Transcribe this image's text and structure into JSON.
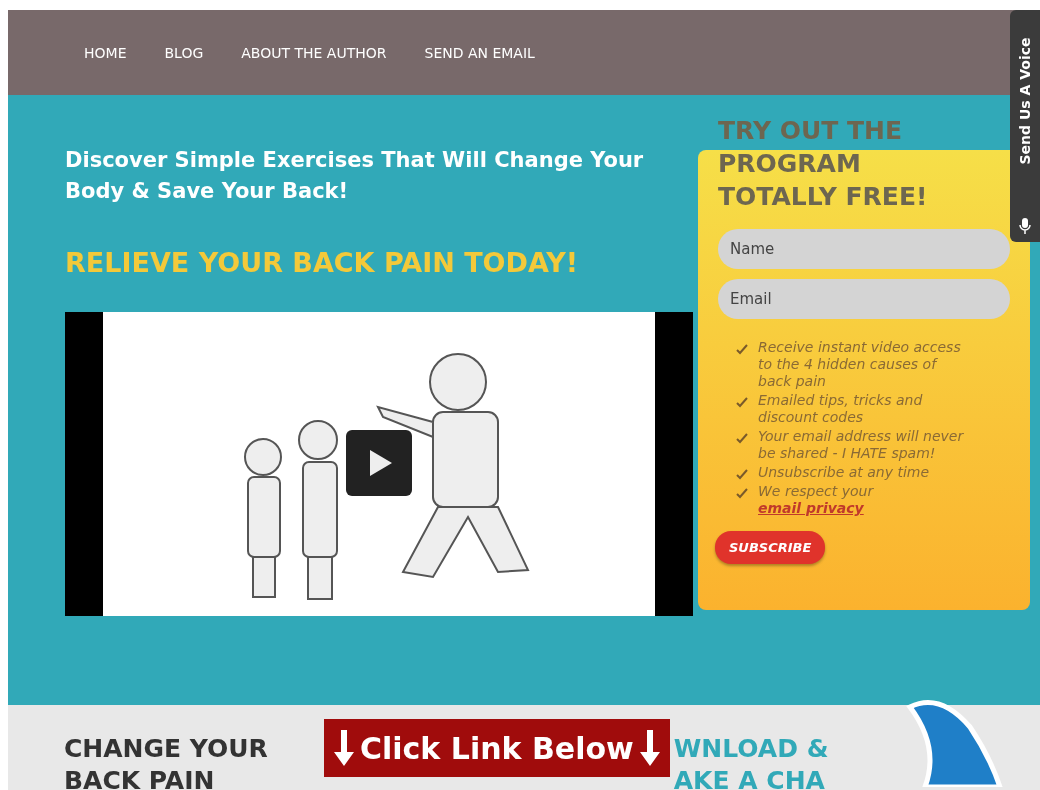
{
  "nav": {
    "items": [
      {
        "label": "HOME"
      },
      {
        "label": "BLOG"
      },
      {
        "label": "ABOUT THE AUTHOR"
      },
      {
        "label": "SEND AN EMAIL"
      }
    ]
  },
  "hero": {
    "title": "Discover Simple Exercises That Will Change Your Body & Save Your Back!",
    "headline": "RELIEVE YOUR BACK PAIN TODAY!"
  },
  "signup": {
    "title": "TRY OUT THE PROGRAM TOTALLY FREE!",
    "fields": [
      {
        "placeholder": "Name"
      },
      {
        "placeholder": "Email"
      }
    ],
    "benefits": [
      {
        "text": "Receive instant video access to the 4 hidden causes of back pain"
      },
      {
        "text": "Emailed tips, tricks and discount codes"
      },
      {
        "text": "Your email address will never be shared - I HATE spam!"
      },
      {
        "text": "Unsubscribe at any time"
      },
      {
        "text": "We respect your ",
        "link": "email privacy"
      }
    ],
    "button": "SUBSCRIBE"
  },
  "voice_tab": {
    "label": "Send Us A Voice"
  },
  "bottom": {
    "left_heading": [
      "CHANGE YOUR",
      "BACK PAIN"
    ],
    "banner": "Click Link Below",
    "right_heading": [
      "WNLOAD &",
      "AKE A CHA"
    ]
  }
}
